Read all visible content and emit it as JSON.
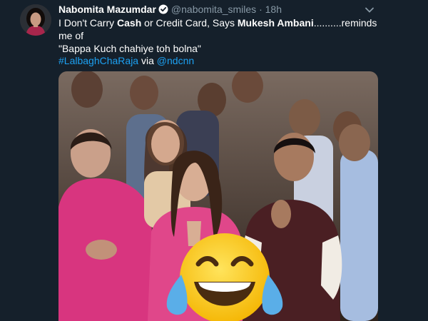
{
  "tweet": {
    "author_name": "Nabomita Mazumdar",
    "handle": "@nabomita_smiles",
    "separator": "·",
    "time": "18h",
    "text": {
      "p1": "I Don't Carry ",
      "b1": "Cash",
      "p2": " or Credit Card, Says ",
      "b2": "Mukesh Ambani",
      "p3": "..........reminds me of",
      "line2": "\"Bappa Kuch chahiye toh bolna\""
    },
    "hashtag": "#LalbaghChaRaja",
    "via": " via ",
    "mention": "@ndcnn"
  },
  "icons": {
    "verified": "verified-badge-icon",
    "menu": "chevron-down-icon",
    "emoji": "tears-of-joy-emoji"
  },
  "colors": {
    "background": "#15202b",
    "text": "#ffffff",
    "muted": "#8899a6",
    "link": "#1da1f2"
  }
}
